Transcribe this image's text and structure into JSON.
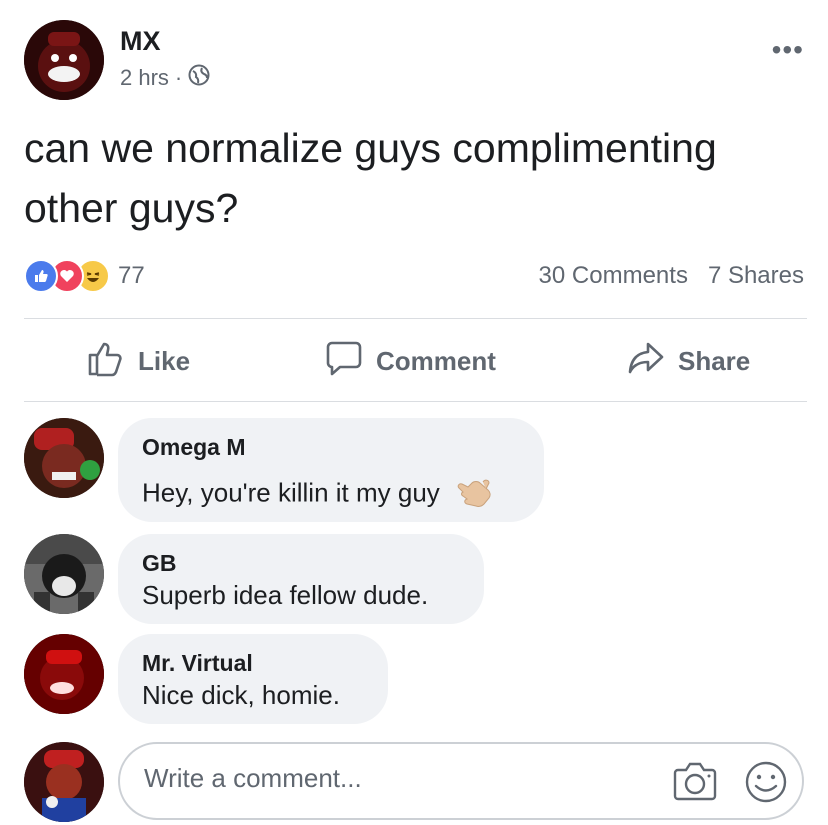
{
  "post": {
    "author": "MX",
    "time": "2 hrs",
    "separator": "·",
    "text": "can we normalize guys complimenting other guys?",
    "more": "•••"
  },
  "reactions": {
    "icons": [
      "like-icon",
      "love-icon",
      "haha-icon"
    ],
    "count": "77",
    "comments": "30 Comments",
    "shares": "7 Shares"
  },
  "actions": {
    "like": "Like",
    "comment": "Comment",
    "share": "Share"
  },
  "comments": [
    {
      "name": "Omega M",
      "text": "Hey, you're killin it my guy"
    },
    {
      "name": "GB",
      "text": "Superb idea fellow dude."
    },
    {
      "name": "Mr. Virtual",
      "text": "Nice dick, homie."
    }
  ],
  "composer": {
    "placeholder": "Write a comment...",
    "icons": [
      "camera-icon",
      "emoji-icon"
    ]
  },
  "colors": {
    "like_blue": "#4b7bec",
    "love_red": "#f0425d",
    "haha_yellow": "#f7c948",
    "text_secondary": "#606770",
    "bubble_bg": "#f0f2f5"
  }
}
